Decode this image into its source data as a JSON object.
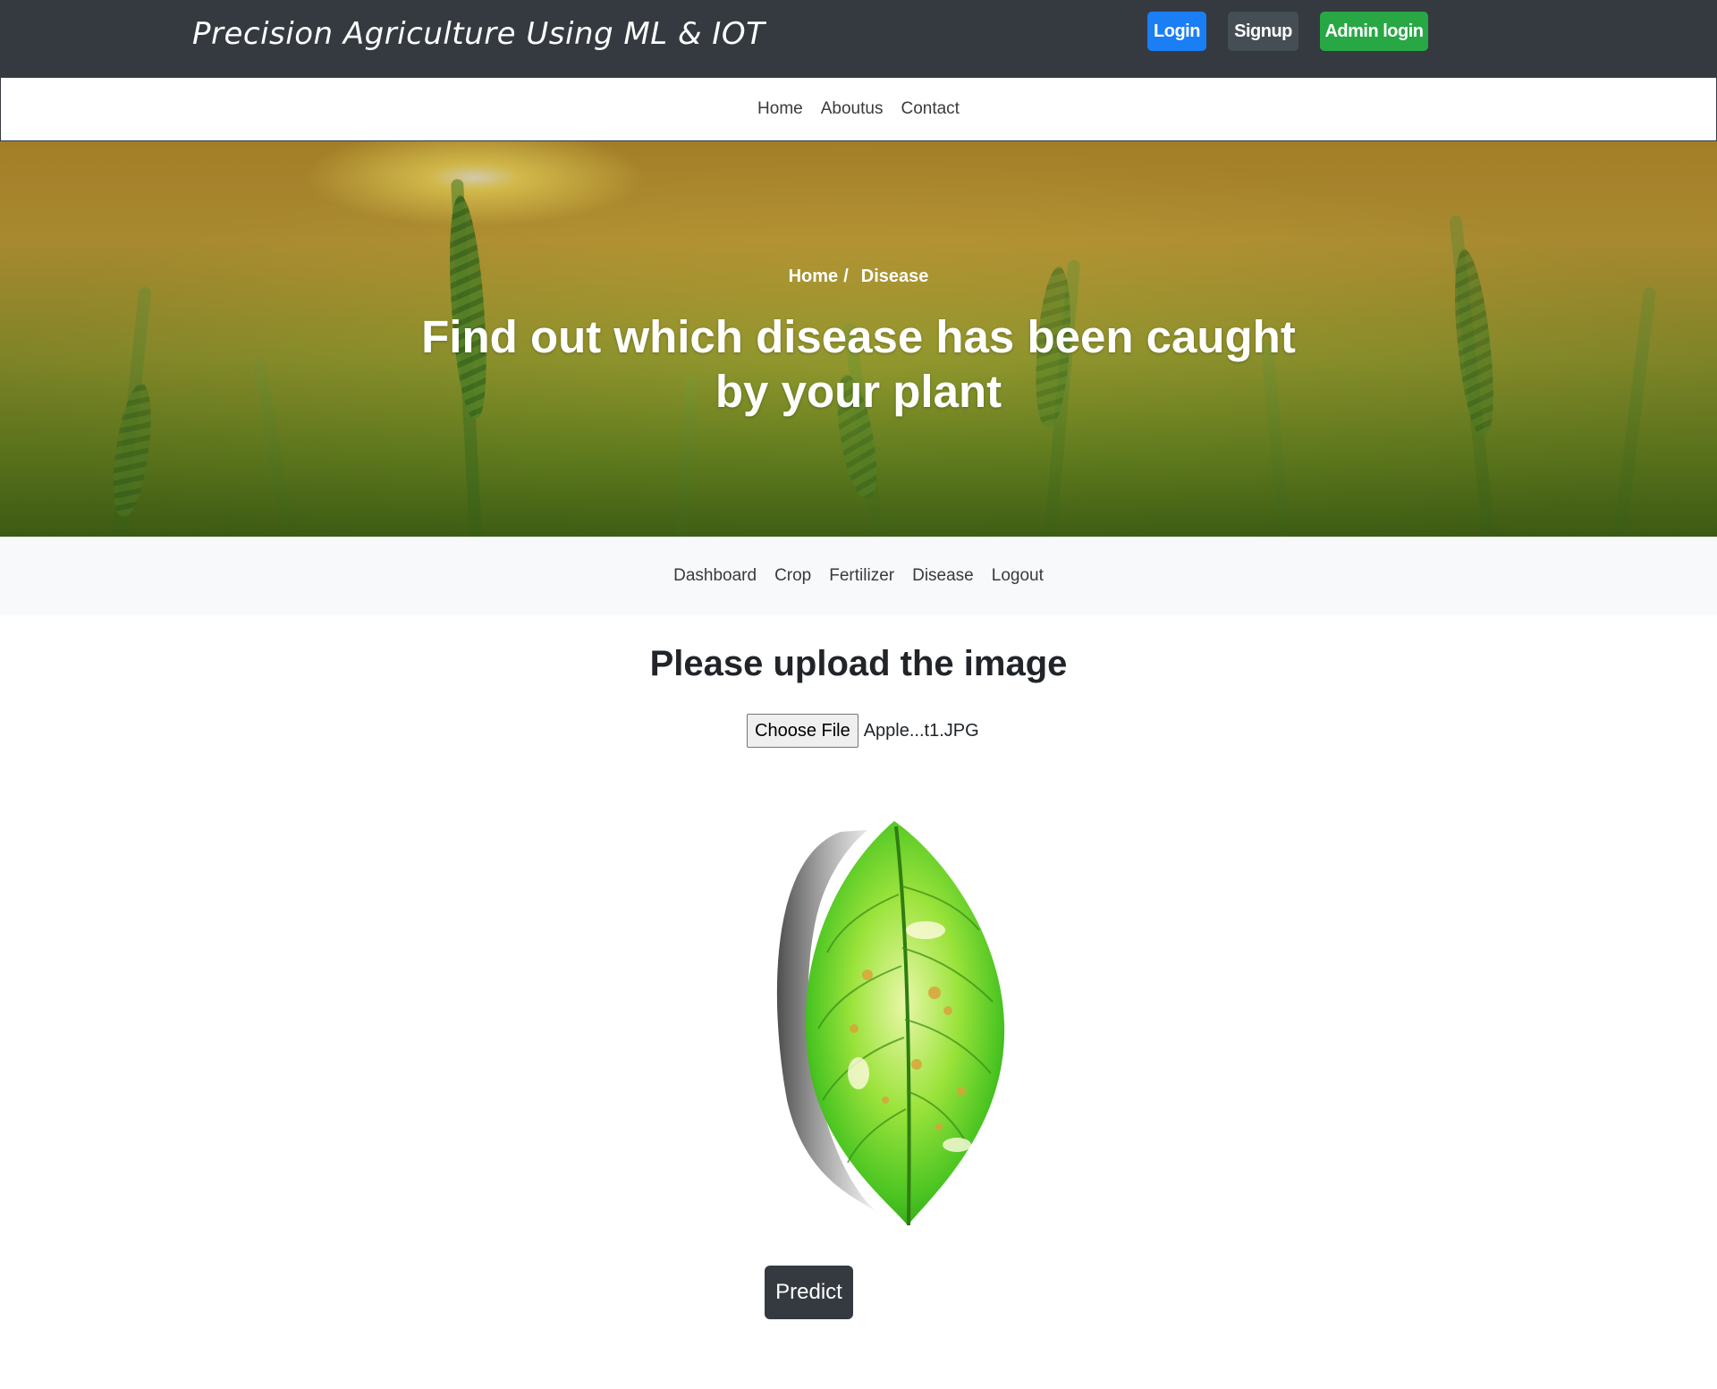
{
  "header": {
    "brand": "Precision Agriculture Using ML & IOT",
    "login_label": "Login",
    "signup_label": "Signup",
    "admin_login_label": "Admin login"
  },
  "top_nav": {
    "items": [
      {
        "label": "Home"
      },
      {
        "label": "Aboutus"
      },
      {
        "label": "Contact"
      }
    ]
  },
  "hero": {
    "breadcrumb_home": "Home",
    "breadcrumb_separator": "/",
    "breadcrumb_current": "Disease",
    "title": "Find out which disease has been caught by your plant"
  },
  "sub_nav": {
    "items": [
      {
        "label": "Dashboard"
      },
      {
        "label": "Crop"
      },
      {
        "label": "Fertilizer"
      },
      {
        "label": "Disease"
      },
      {
        "label": "Logout"
      }
    ]
  },
  "upload": {
    "title": "Please upload the image",
    "choose_file_label": "Choose File",
    "file_name": "Apple...t1.JPG",
    "predict_label": "Predict"
  },
  "colors": {
    "header_bg": "#343a40",
    "login": "#1a7ef5",
    "signup": "#454d55",
    "admin_login": "#28a745",
    "subnav_bg": "#f8f9fa"
  }
}
